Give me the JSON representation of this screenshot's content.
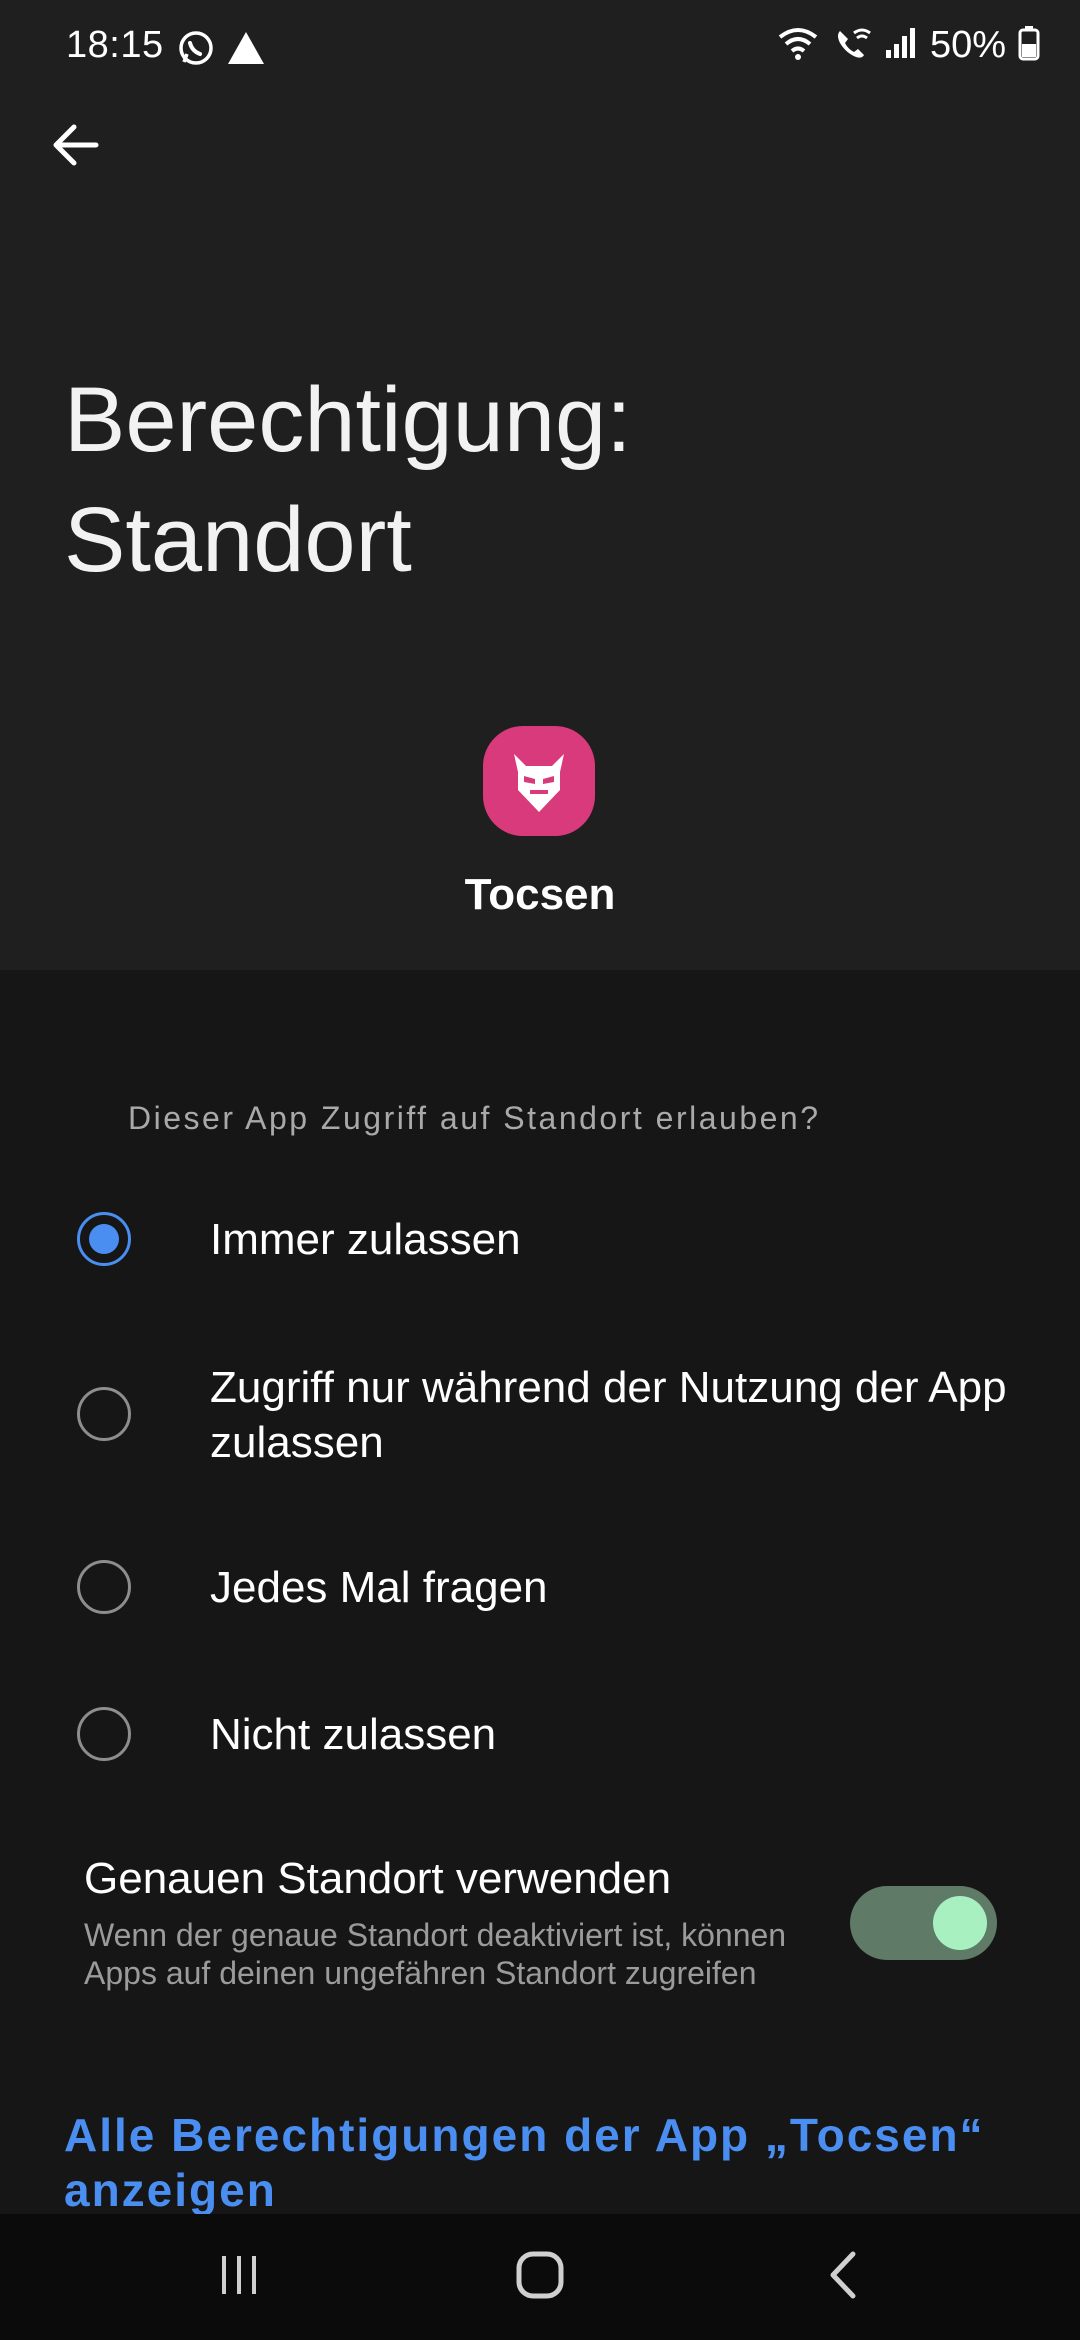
{
  "status_bar": {
    "time": "18:15",
    "battery": "50%",
    "icons": [
      "whatsapp-icon",
      "warning-triangle-icon",
      "wifi-icon",
      "wifi-calling-icon",
      "signal-icon",
      "battery-icon"
    ]
  },
  "header": {
    "back_icon": "arrow-left-icon",
    "title_line1": "Berechtigung:",
    "title_line2": "Standort"
  },
  "app": {
    "name": "Tocsen",
    "icon_color": "#d93a7b"
  },
  "permission": {
    "question": "Dieser App Zugriff auf Standort erlauben?",
    "options": [
      {
        "label": "Immer zulassen",
        "selected": true
      },
      {
        "label": "Zugriff nur während der Nutzung der App zulassen",
        "selected": false
      },
      {
        "label": "Jedes Mal fragen",
        "selected": false
      },
      {
        "label": "Nicht zulassen",
        "selected": false
      }
    ]
  },
  "precise_location": {
    "title": "Genauen Standort verwenden",
    "subtitle": "Wenn der genaue Standort deaktiviert ist, können Apps auf deinen ungefähren Standort zugreifen",
    "enabled": true
  },
  "all_permissions_link": "Alle Berechtigungen der App „Tocsen“ anzeigen",
  "navbar": {
    "icons": [
      "recent-apps-icon",
      "home-icon",
      "back-icon"
    ]
  },
  "colors": {
    "accent": "#4a8ef2",
    "toggle_track": "#5f7a66",
    "toggle_knob": "#a8f0c0"
  }
}
